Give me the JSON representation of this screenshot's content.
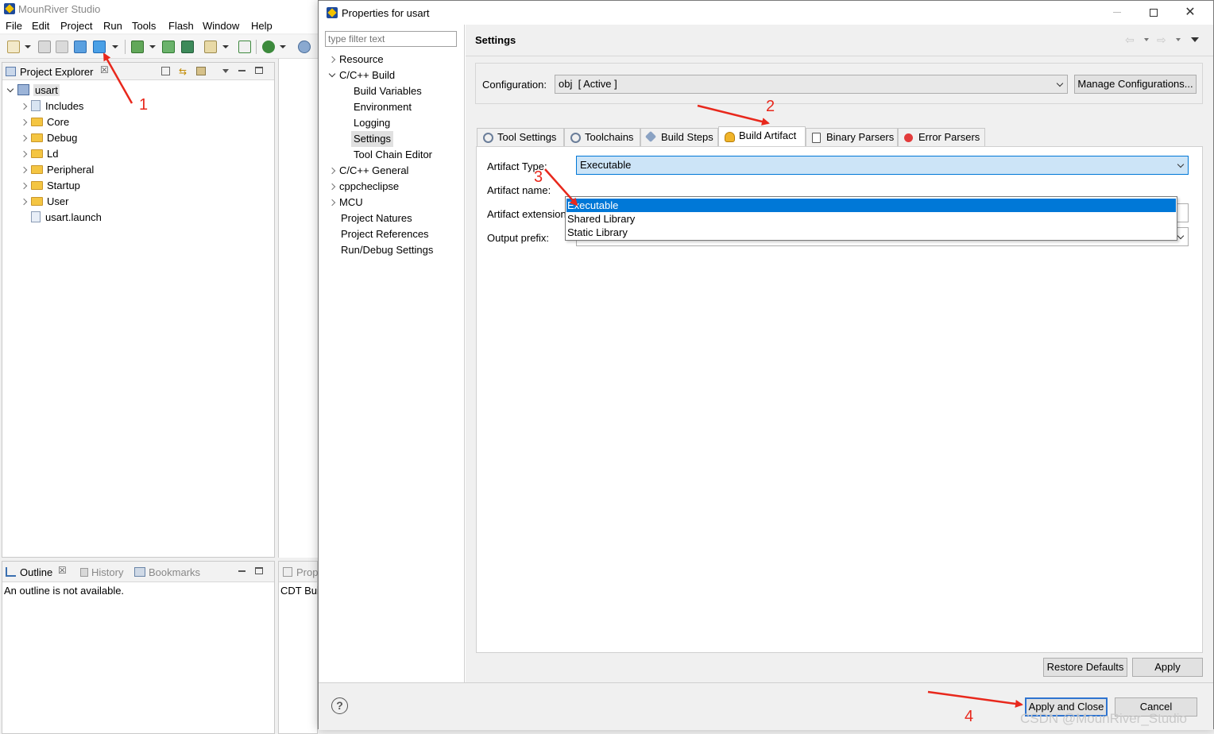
{
  "ide": {
    "title": "MounRiver Studio",
    "menu": [
      "File",
      "Edit",
      "Project",
      "Run",
      "Tools",
      "Flash",
      "Window",
      "Help"
    ],
    "project_explorer": {
      "title": "Project Explorer",
      "project": "usart",
      "items": [
        "Includes",
        "Core",
        "Debug",
        "Ld",
        "Peripheral",
        "Startup",
        "User"
      ],
      "launch_file": "usart.launch"
    },
    "bottom_tabs": [
      "Outline",
      "History",
      "Bookmarks"
    ],
    "outline_message": "An outline is not available.",
    "mid_tab": "Prop",
    "mid_text": "CDT Bui"
  },
  "dialog": {
    "title": "Properties for usart",
    "filter_placeholder": "type filter text",
    "nav": {
      "resource": "Resource",
      "cpp_build": "C/C++ Build",
      "build_variables": "Build Variables",
      "environment": "Environment",
      "logging": "Logging",
      "settings": "Settings",
      "tool_chain_editor": "Tool Chain Editor",
      "cpp_general": "C/C++ General",
      "cppcheclipse": "cppcheclipse",
      "mcu": "MCU",
      "project_natures": "Project Natures",
      "project_references": "Project References",
      "run_debug": "Run/Debug Settings"
    },
    "section_title": "Settings",
    "configuration_label": "Configuration:",
    "configuration_value": "obj  [ Active ]",
    "manage_configurations": "Manage Configurations...",
    "tabs": [
      "Tool Settings",
      "Toolchains",
      "Build Steps",
      "Build Artifact",
      "Binary Parsers",
      "Error Parsers"
    ],
    "active_tab": "Build Artifact",
    "fields": {
      "artifact_type_label": "Artifact Type:",
      "artifact_type_value": "Executable",
      "artifact_name_label": "Artifact name:",
      "artifact_extension_label": "Artifact extension:",
      "output_prefix_label": "Output prefix:"
    },
    "dropdown_options": [
      "Executable",
      "Shared Library",
      "Static Library"
    ],
    "restore_defaults": "Restore Defaults",
    "apply": "Apply",
    "apply_and_close": "Apply and Close",
    "cancel": "Cancel",
    "help": "?"
  },
  "annotations": [
    "1",
    "2",
    "3",
    "4"
  ],
  "watermark": "CSDN @MounRiver_Studio",
  "colors": {
    "selection": "#0078d7",
    "combo_focus": "#cce4f7",
    "annotation": "#e8281c"
  }
}
